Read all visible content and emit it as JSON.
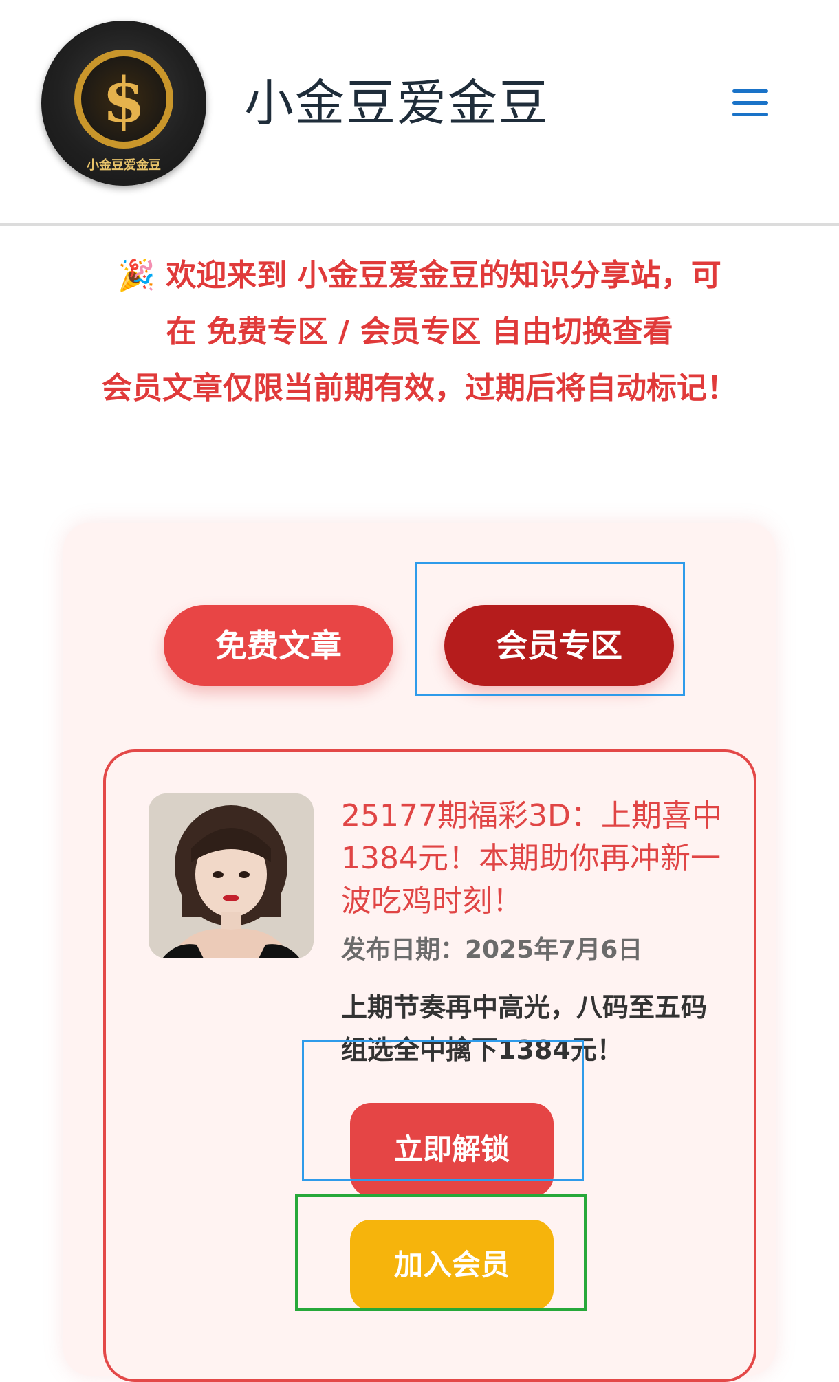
{
  "header": {
    "logo_text": "小金豆爱金豆",
    "logo_symbol": "$",
    "site_title": "小金豆爱金豆",
    "menu_icon": "hamburger-icon"
  },
  "notice": {
    "line1": "🎉 欢迎来到 小金豆爱金豆的知识分享站，可",
    "line2": "在 免费专区 / 会员专区 自由切换查看",
    "line3": "会员文章仅限当前期有效，过期后将自动标记！",
    "color": "#e03a3a"
  },
  "tabs": {
    "free_label": "免费文章",
    "member_label": "会员专区",
    "active": "member"
  },
  "article": {
    "title": "25177期福彩3D：上期喜中1384元！本期助你再冲新一波吃鸡时刻！",
    "date": "发布日期：2025年7月6日",
    "description": "上期节奏再中高光，八码至五码组选全中擒下1384元！",
    "unlock_label": "立即解锁",
    "join_label": "加入会员"
  },
  "colors": {
    "primary_red": "#e84545",
    "dark_red": "#b51c1c",
    "gold": "#f6b40c",
    "panel_bg": "#fff3f2",
    "menu_blue": "#1a73c8"
  }
}
